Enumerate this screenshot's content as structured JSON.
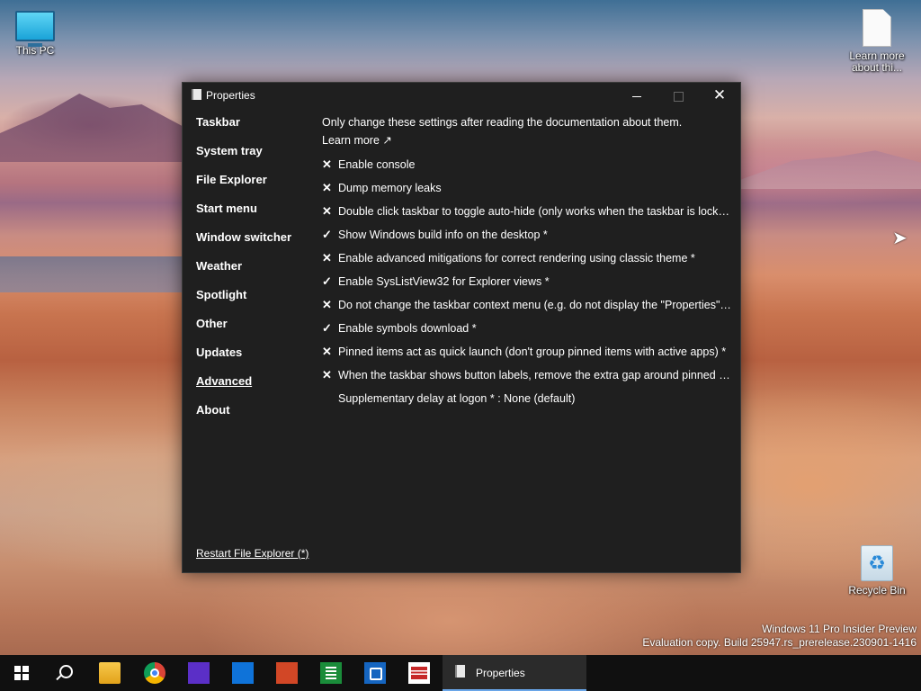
{
  "desktop": {
    "icons": {
      "this_pc": "This PC",
      "learn_more": "Learn more about thi...",
      "recycle_bin": "Recycle Bin"
    },
    "watermark": {
      "line1": "Windows 11 Pro Insider Preview",
      "line2": "Evaluation copy. Build 25947.rs_prerelease.230901-1416"
    }
  },
  "window": {
    "title": "Properties",
    "controls": {
      "minimize": "minimize",
      "maximize": "maximize",
      "close": "✕"
    },
    "sidebar": {
      "items": [
        {
          "label": "Taskbar"
        },
        {
          "label": "System tray"
        },
        {
          "label": "File Explorer"
        },
        {
          "label": "Start menu"
        },
        {
          "label": "Window switcher"
        },
        {
          "label": "Weather"
        },
        {
          "label": "Spotlight"
        },
        {
          "label": "Other"
        },
        {
          "label": "Updates"
        },
        {
          "label": "Advanced",
          "active": true
        },
        {
          "label": "About"
        }
      ],
      "restart_link": "Restart File Explorer (*)"
    },
    "content": {
      "intro": "Only change these settings after reading the documentation about them.",
      "learn_more": "Learn more ↗",
      "options": [
        {
          "mark": "✕",
          "label": "Enable console"
        },
        {
          "mark": "✕",
          "label": "Dump memory leaks"
        },
        {
          "mark": "✕",
          "label": "Double click taskbar to toggle auto-hide (only works when the taskbar is locked)"
        },
        {
          "mark": "✓",
          "label": "Show Windows build info on the desktop *"
        },
        {
          "mark": "✕",
          "label": "Enable advanced mitigations for correct rendering using classic theme *"
        },
        {
          "mark": "✓",
          "label": "Enable SysListView32 for Explorer views *"
        },
        {
          "mark": "✕",
          "label": "Do not change the taskbar context menu (e.g. do not display the \"Properties\" ite..."
        },
        {
          "mark": "✓",
          "label": "Enable symbols download *"
        },
        {
          "mark": "✕",
          "label": "Pinned items act as quick launch (don't group pinned items with active apps) *"
        },
        {
          "mark": "✕",
          "label": "When the taskbar shows button labels, remove the extra gap around pinned ite..."
        },
        {
          "mark": "",
          "label": "Supplementary delay at logon * : None (default)"
        }
      ]
    }
  },
  "taskbar": {
    "running_app_label": "Properties"
  }
}
